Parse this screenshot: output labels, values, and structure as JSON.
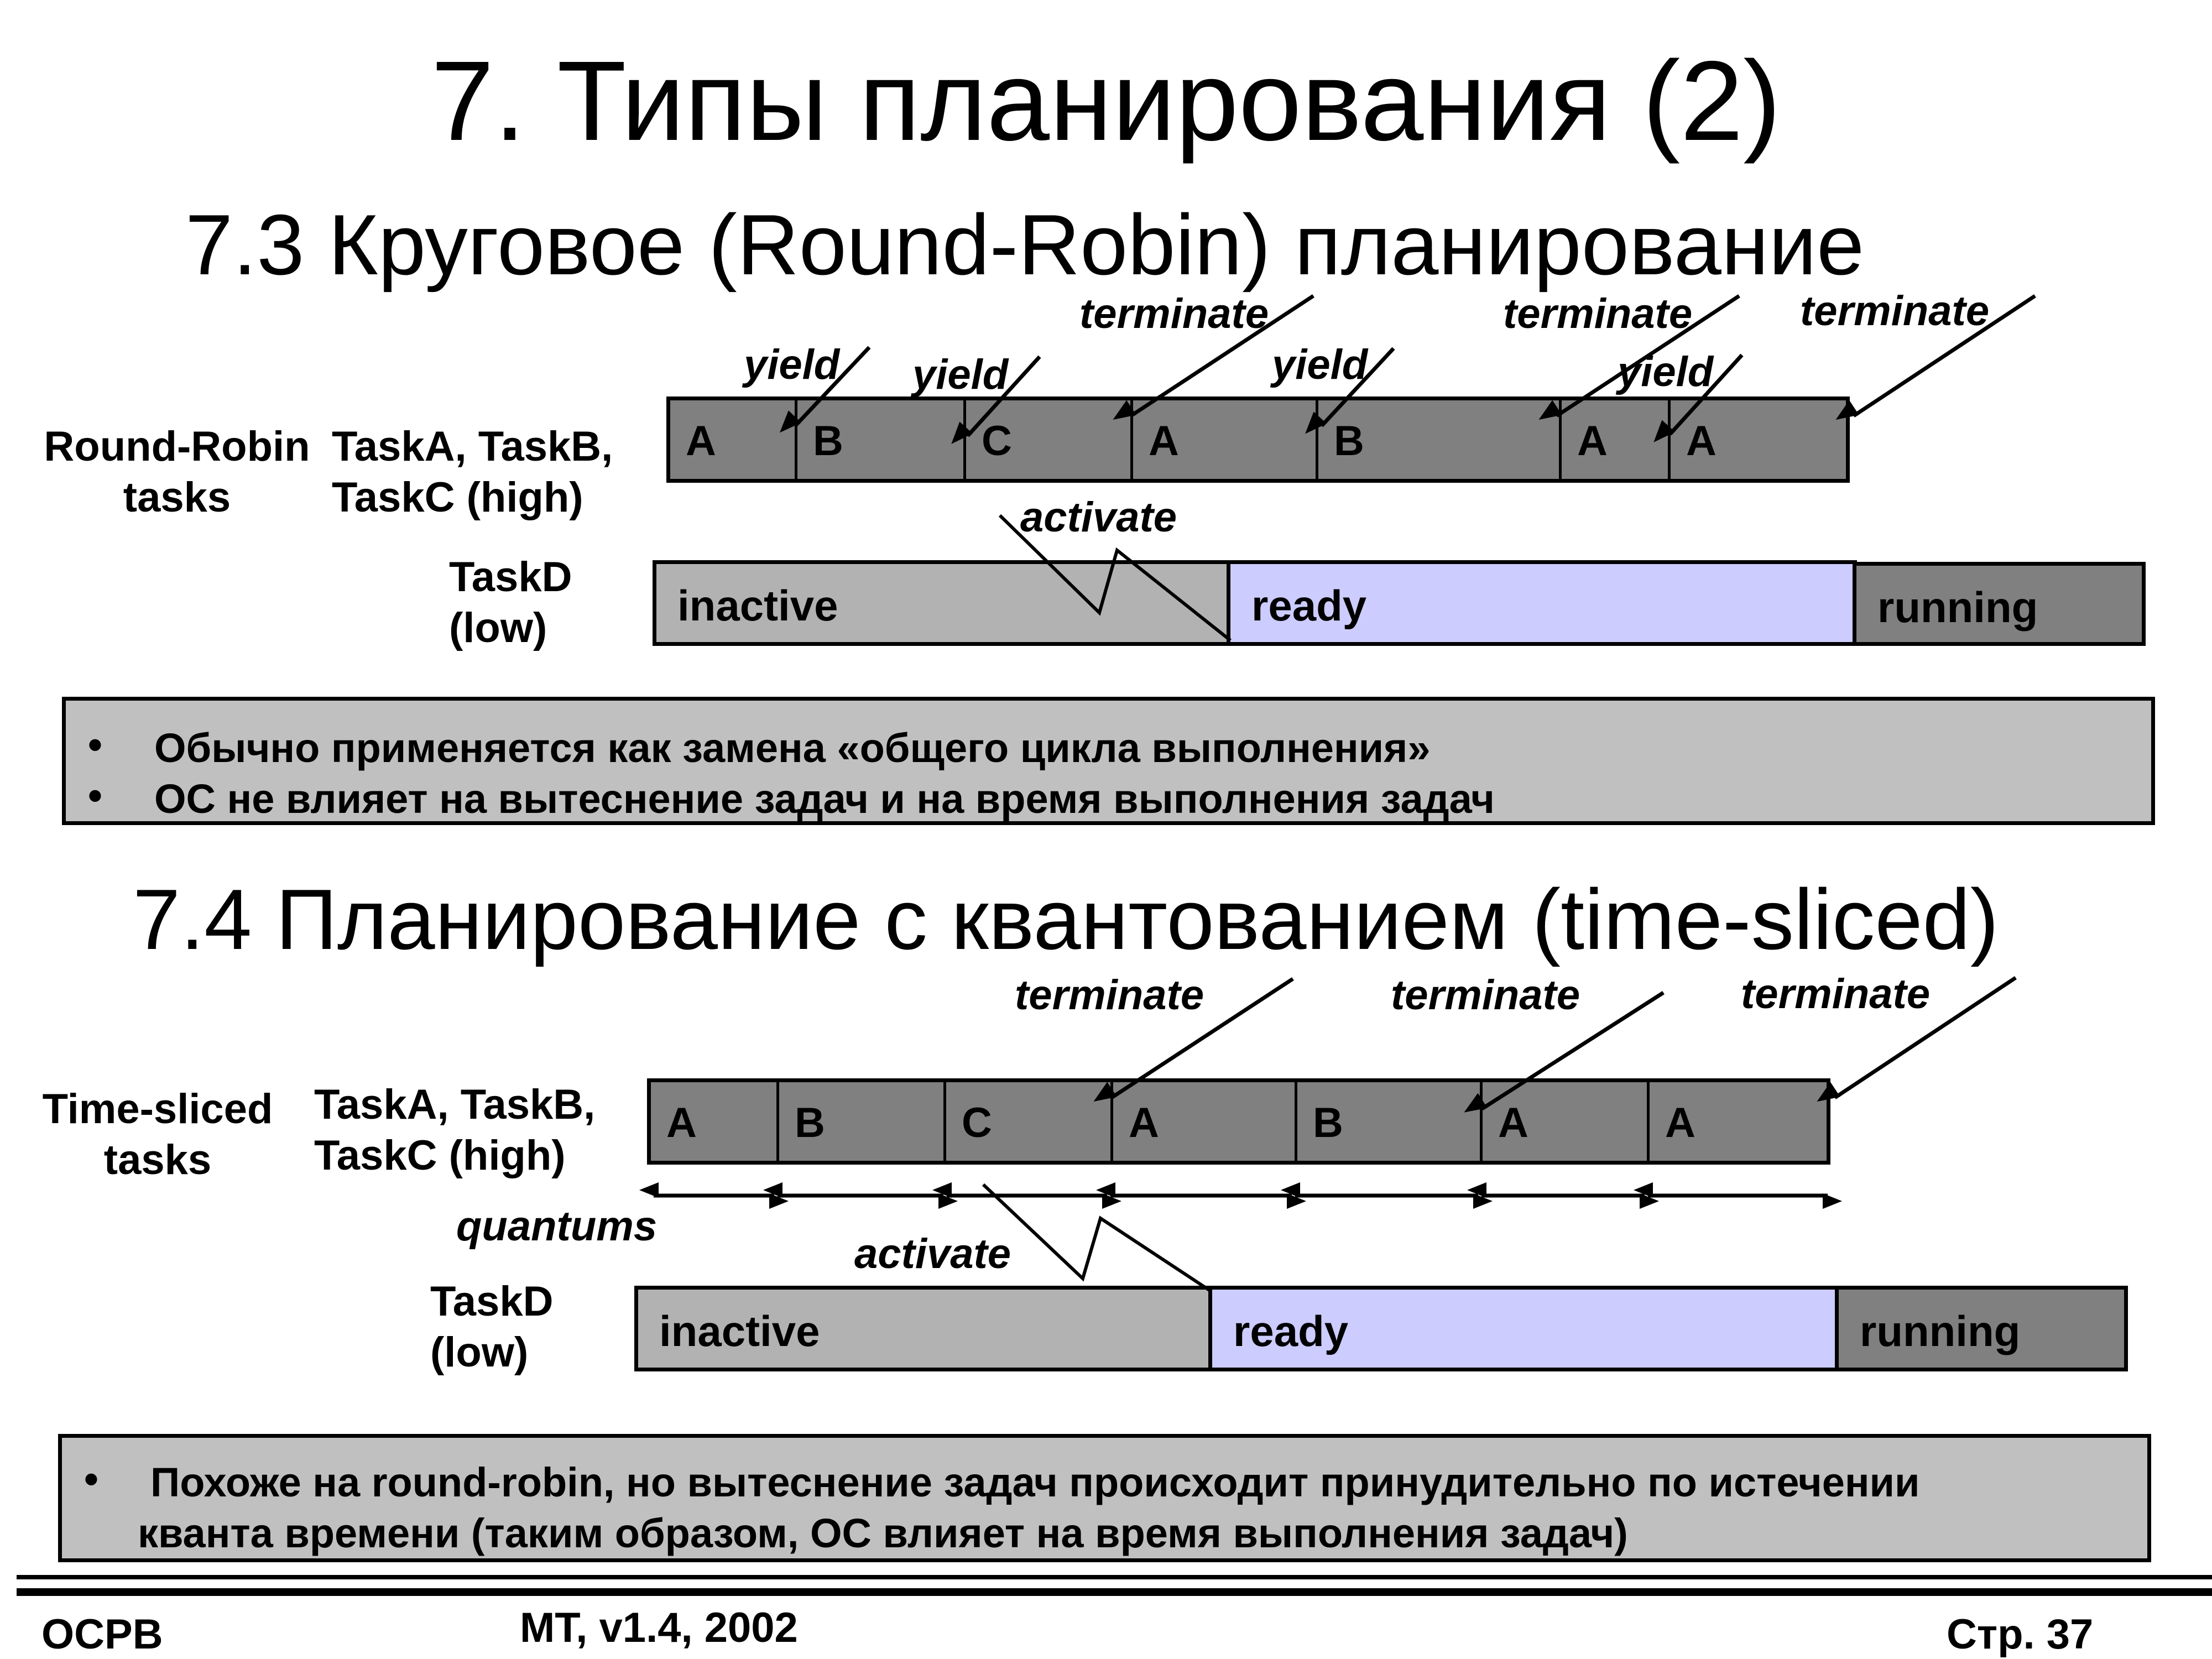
{
  "slide": {
    "title": "7. Типы планирования (2)",
    "sections": [
      {
        "heading": "7.3 Круговое (Round-Robin) планирование",
        "group_label": "Round-Robin\ntasks",
        "group_label_lines": [
          "Round-Robin",
          "tasks"
        ],
        "tasks_label_lines": [
          "TaskA, TaskB,",
          "TaskC (high)"
        ],
        "timeline": [
          "A",
          "B",
          "C",
          "A",
          "B",
          "A",
          "A"
        ],
        "events": {
          "yield": [
            "yield",
            "yield",
            "yield",
            "yield"
          ],
          "terminate": [
            "terminate",
            "terminate",
            "terminate"
          ],
          "activate": "activate"
        },
        "low_task_label_lines": [
          "TaskD",
          "(low)"
        ],
        "states": [
          "inactive",
          "ready",
          "running"
        ],
        "notes": [
          "Обычно применяется как замена «общего цикла выполнения»",
          "ОС не влияет на вытеснение задач и на время выполнения задач"
        ]
      },
      {
        "heading": "7.4 Планирование с квантованием (time-sliced)",
        "group_label_lines": [
          "Time-sliced",
          "tasks"
        ],
        "tasks_label_lines": [
          "TaskA, TaskB,",
          "TaskC (high)"
        ],
        "timeline": [
          "A",
          "B",
          "C",
          "A",
          "B",
          "A",
          "A"
        ],
        "events": {
          "terminate": [
            "terminate",
            "terminate",
            "terminate"
          ],
          "activate": "activate",
          "quantums": "quantums"
        },
        "low_task_label_lines": [
          "TaskD",
          "(low)"
        ],
        "states": [
          "inactive",
          "ready",
          "running"
        ],
        "notes": [
          "Похоже на round-robin, но вытеснение задач происходит принудительно по истечении кванта времени (таким образом, ОС влияет на время выполнения задач)"
        ],
        "notes_lines": [
          "Похоже на round-robin, но вытеснение задач происходит принудительно по истечении",
          "кванта времени (таким образом, ОС влияет на время выполнения задач)"
        ]
      }
    ],
    "colors": {
      "task_segment": "#808080",
      "inactive": "#b2b2b2",
      "ready": "#ccccff",
      "running": "#808080",
      "note_box": "#c0c0c0"
    },
    "footer": {
      "left": "ОСРВ",
      "center": "MT, v1.4, 2002",
      "right": "Стр. 37"
    }
  }
}
